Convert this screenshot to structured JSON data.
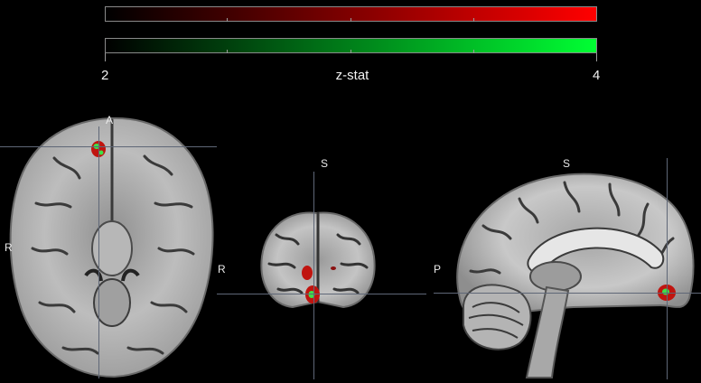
{
  "colorbar": {
    "title": "z-stat",
    "min_label": "2",
    "max_label": "4",
    "positive_colors": [
      "#000000",
      "#ff0000"
    ],
    "secondary_colors": [
      "#000000",
      "#00ff33"
    ]
  },
  "views": {
    "axial": {
      "label_anterior": "A",
      "label_right": "R"
    },
    "coronal": {
      "label_superior": "S",
      "label_right": "R"
    },
    "sagittal": {
      "label_superior": "S",
      "label_posterior": "P"
    }
  },
  "colors": {
    "background": "#000000",
    "crosshair": "#5f6777",
    "activation_red": "#c0140f",
    "activation_green": "#3ee04a"
  }
}
